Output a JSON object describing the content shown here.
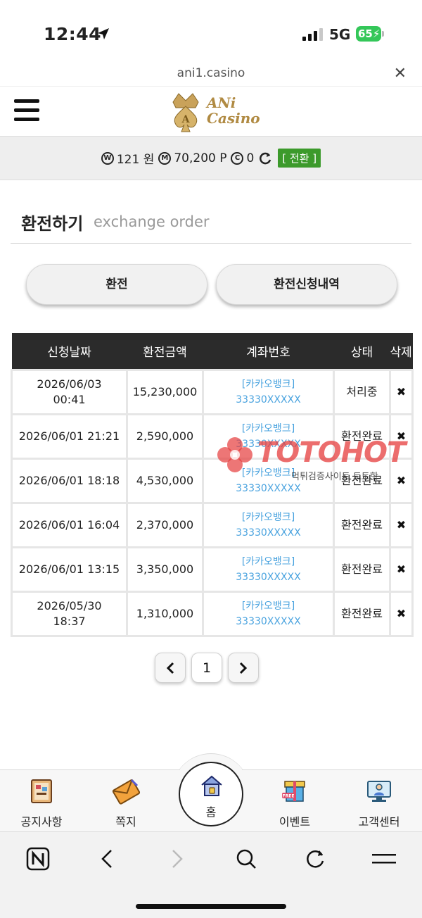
{
  "status_bar": {
    "time": "12:44",
    "network": "5G",
    "battery": "65"
  },
  "browser": {
    "url": "ani1.casino",
    "close_icon": "close-icon"
  },
  "header": {
    "logo_line1": "ANi",
    "logo_line2": "Casino",
    "menu_icon": "hamburger-icon"
  },
  "balance": {
    "won_icon": "W",
    "won_value": "121 원",
    "point_icon": "M",
    "point_value": "70,200 P",
    "coupon_icon": "C",
    "coupon_value": "0",
    "switch_label": "[ 전환 ]"
  },
  "page": {
    "title": "환전하기",
    "subtitle": "exchange order"
  },
  "tabs": [
    {
      "label": "환전"
    },
    {
      "label": "환전신청내역"
    }
  ],
  "table": {
    "headers": [
      "신청날짜",
      "환전금액",
      "계좌번호",
      "상태",
      "삭제"
    ],
    "rows": [
      {
        "date": "2026/06/03",
        "time": "00:41",
        "amount": "15,230,000",
        "bank": "[카카오뱅크]",
        "account": "33330XXXXX",
        "status": "처리중"
      },
      {
        "date": "2026/06/01 21:21",
        "time": "",
        "amount": "2,590,000",
        "bank": "[카카오뱅크]",
        "account": "33330XXXXX",
        "status": "환전완료"
      },
      {
        "date": "2026/06/01 18:18",
        "time": "",
        "amount": "4,530,000",
        "bank": "[카카오뱅크]",
        "account": "33330XXXXX",
        "status": "환전완료"
      },
      {
        "date": "2026/06/01 16:04",
        "time": "",
        "amount": "2,370,000",
        "bank": "[카카오뱅크]",
        "account": "33330XXXXX",
        "status": "환전완료"
      },
      {
        "date": "2026/06/01 13:15",
        "time": "",
        "amount": "3,350,000",
        "bank": "[카카오뱅크]",
        "account": "33330XXXXX",
        "status": "환전완료"
      },
      {
        "date": "2026/05/30",
        "time": "18:37",
        "amount": "1,310,000",
        "bank": "[카카오뱅크]",
        "account": "33330XXXXX",
        "status": "환전완료"
      }
    ]
  },
  "watermark": {
    "text": "TOTOHOT",
    "sub": "먹튀검증사이트 토토핫"
  },
  "pagination": {
    "current": "1"
  },
  "bottom_nav": {
    "items": [
      {
        "label": "공지사항",
        "icon": "notice-board-icon"
      },
      {
        "label": "쪽지",
        "icon": "message-envelope-icon"
      },
      {
        "label": "홈",
        "icon": "home-icon"
      },
      {
        "label": "이벤트",
        "icon": "event-gift-icon"
      },
      {
        "label": "고객센터",
        "icon": "customer-support-icon"
      }
    ]
  },
  "colors": {
    "accent_green": "#3c9a2b",
    "link_blue": "#4aa3df",
    "header_dark": "#2b2b2b"
  }
}
